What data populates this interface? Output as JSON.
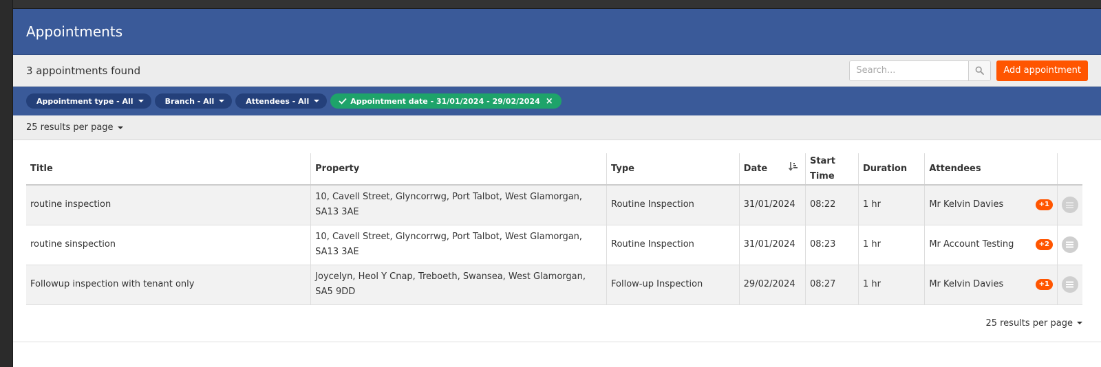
{
  "header": {
    "title": "Appointments"
  },
  "toolbar": {
    "count_text": "3 appointments found",
    "search_placeholder": "Search...",
    "search_value": "",
    "search_icon": "search-icon",
    "add_label": "Add appointment"
  },
  "filters": [
    {
      "label": "Appointment type - All",
      "active": false
    },
    {
      "label": "Branch - All",
      "active": false
    },
    {
      "label": "Attendees - All",
      "active": false
    },
    {
      "label": "Appointment date - 31/01/2024 - 29/02/2024",
      "active": true,
      "close": "×"
    }
  ],
  "per_page_top": "25 results per page",
  "per_page_bottom": "25 results per page",
  "colors": {
    "brand": "#3a5a99",
    "accent": "#ff5500",
    "active_filter": "#1ea36a"
  },
  "table": {
    "columns": [
      "Title",
      "Property",
      "Type",
      "Date",
      "Start Time",
      "Duration",
      "Attendees",
      ""
    ],
    "sorted_column": "Date",
    "rows": [
      {
        "title": "routine inspection",
        "property": "10, Cavell Street, Glyncorrwg, Port Talbot, West Glamorgan, SA13 3AE",
        "type": "Routine Inspection",
        "date": "31/01/2024",
        "start": "08:22",
        "duration": "1 hr",
        "attendee": "Mr Kelvin Davies",
        "extra": "+1"
      },
      {
        "title": "routine sinspection",
        "property": "10, Cavell Street, Glyncorrwg, Port Talbot, West Glamorgan, SA13 3AE",
        "type": "Routine Inspection",
        "date": "31/01/2024",
        "start": "08:23",
        "duration": "1 hr",
        "attendee": "Mr Account Testing",
        "extra": "+2"
      },
      {
        "title": "Followup inspection with tenant only",
        "property": "Joycelyn, Heol Y Cnap, Treboeth, Swansea, West Glamorgan, SA5 9DD",
        "type": "Follow-up Inspection",
        "date": "29/02/2024",
        "start": "08:27",
        "duration": "1 hr",
        "attendee": "Mr Kelvin Davies",
        "extra": "+1"
      }
    ]
  }
}
